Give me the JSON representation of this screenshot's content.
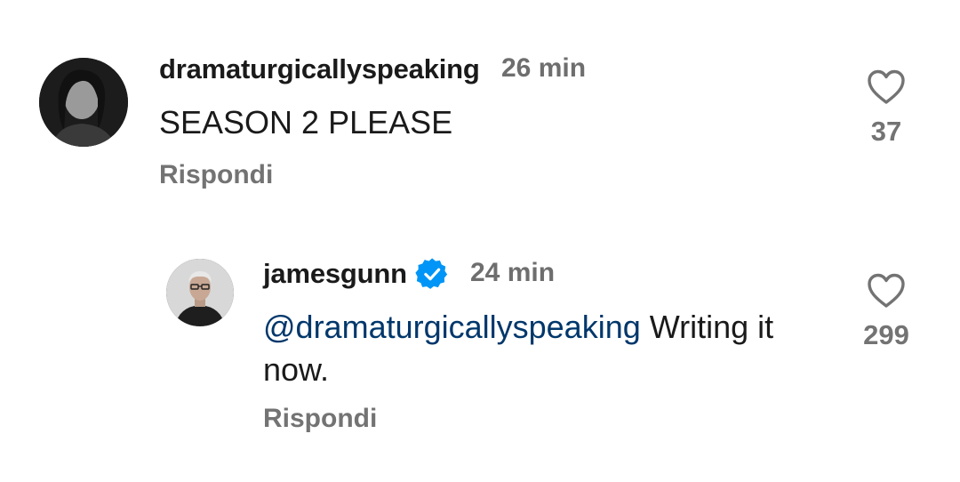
{
  "comments": [
    {
      "username": "dramaturgicallyspeaking",
      "time": "26 min",
      "text": "SEASON 2 PLEASE",
      "reply_label": "Rispondi",
      "likes": "37",
      "verified": false
    },
    {
      "username": "jamesgunn",
      "time": "24 min",
      "mention": "@dramaturgicallyspeaking",
      "text": " Writing it now.",
      "reply_label": "Rispondi",
      "likes": "299",
      "verified": true
    }
  ],
  "colors": {
    "mention": "#00376b",
    "verified_badge": "#0095f6",
    "muted": "#737373"
  },
  "icons": {
    "like": "heart-icon",
    "verified": "verified-badge-icon"
  }
}
